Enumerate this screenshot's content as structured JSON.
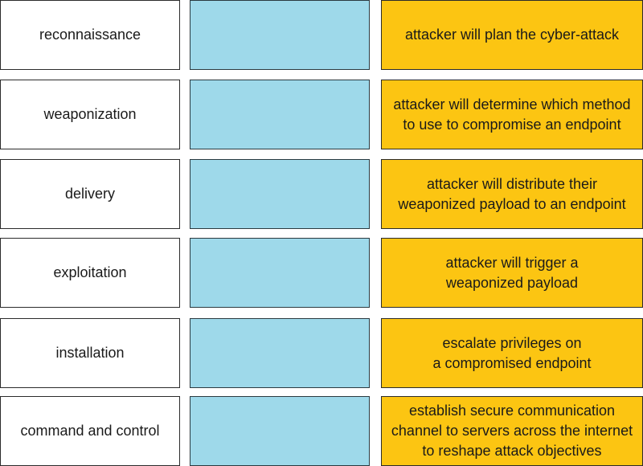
{
  "rows": [
    {
      "step": "reconnaissance",
      "slot": "",
      "description": "attacker will plan the cyber-attack"
    },
    {
      "step": "weaponization",
      "slot": "",
      "description": "attacker will determine which method\nto use to compromise an endpoint"
    },
    {
      "step": "delivery",
      "slot": "",
      "description": "attacker will distribute their\nweaponized payload to an endpoint"
    },
    {
      "step": "exploitation",
      "slot": "",
      "description": "attacker will trigger a\nweaponized payload"
    },
    {
      "step": "installation",
      "slot": "",
      "description": "escalate privileges on\na compromised endpoint"
    },
    {
      "step": "command and control",
      "slot": "",
      "description": "establish secure communication\nchannel to servers across the internet\nto reshape attack objectives"
    }
  ],
  "colors": {
    "slot": "#9ed9ea",
    "description": "#fcc512",
    "step": "#ffffff"
  }
}
